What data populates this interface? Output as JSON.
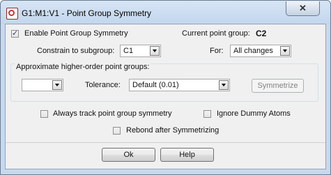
{
  "window": {
    "title": "G1:M1:V1 - Point Group Symmetry",
    "close_glyph": "✕",
    "accent_color": "#c9d9ec"
  },
  "enable": {
    "label": "Enable Point Group Symmetry",
    "checked": true
  },
  "current_group": {
    "label": "Current point group:",
    "value": "C2"
  },
  "constrain": {
    "label": "Constrain to subgroup:",
    "value": "C1"
  },
  "for_field": {
    "label": "For:",
    "value": "All changes"
  },
  "approx": {
    "label": "Approximate higher-order point groups:",
    "group_value": "",
    "tolerance_label": "Tolerance:",
    "tolerance_value": "Default (0.01)",
    "symmetrize_label": "Symmetrize"
  },
  "options": {
    "always_track": {
      "label": "Always track point group symmetry",
      "checked": false
    },
    "ignore_dummy": {
      "label": "Ignore Dummy Atoms",
      "checked": false
    },
    "rebond": {
      "label": "Rebond after Symmetrizing",
      "checked": false
    }
  },
  "buttons": {
    "ok": "Ok",
    "help": "Help"
  }
}
